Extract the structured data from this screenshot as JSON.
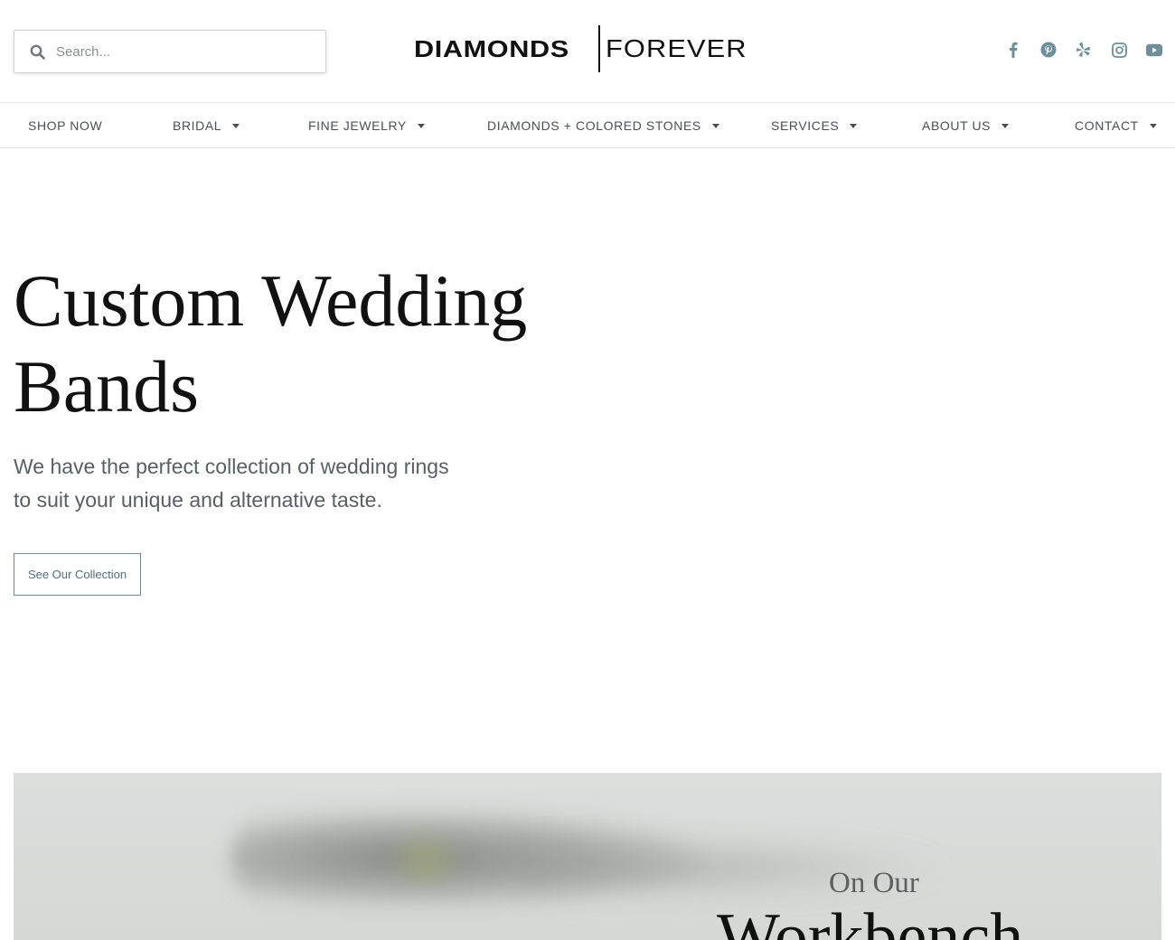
{
  "header": {
    "search": {
      "placeholder": "Search...",
      "value": ""
    },
    "logo": {
      "bold": "DIAMONDS",
      "thin": "FOREVER"
    },
    "social": [
      "facebook-icon",
      "pinterest-icon",
      "yelp-icon",
      "instagram-icon",
      "youtube-icon"
    ]
  },
  "nav": {
    "items": [
      {
        "label": "SHOP NOW",
        "dropdown": false
      },
      {
        "label": "BRIDAL",
        "dropdown": true
      },
      {
        "label": "FINE JEWELRY",
        "dropdown": true
      },
      {
        "label": "DIAMONDS + COLORED STONES",
        "dropdown": true
      },
      {
        "label": "SERVICES",
        "dropdown": true
      },
      {
        "label": "ABOUT US",
        "dropdown": true
      },
      {
        "label": "CONTACT",
        "dropdown": true
      }
    ]
  },
  "hero": {
    "title_line1": "Custom Wedding",
    "title_line2": "Bands",
    "subtitle_line1": "We have the perfect collection of wedding rings",
    "subtitle_line2": "to suit your unique and alternative taste.",
    "cta_label": "See Our Collection"
  },
  "banner": {
    "pre_title": "On Our",
    "title": "Workbench"
  },
  "colors": {
    "accent": "#6c8a97",
    "social_icon": "#6f8e9b",
    "text_dark": "#111111",
    "text_muted": "#5a5f63"
  }
}
